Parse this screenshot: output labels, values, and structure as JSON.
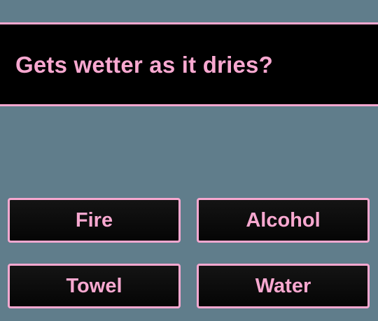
{
  "quiz": {
    "question": "Gets wetter as it dries?",
    "answers": [
      "Fire",
      "Alcohol",
      "Towel",
      "Water"
    ]
  },
  "colors": {
    "background": "#607d8b",
    "accent": "#f8a8d0",
    "panel": "#000000"
  }
}
